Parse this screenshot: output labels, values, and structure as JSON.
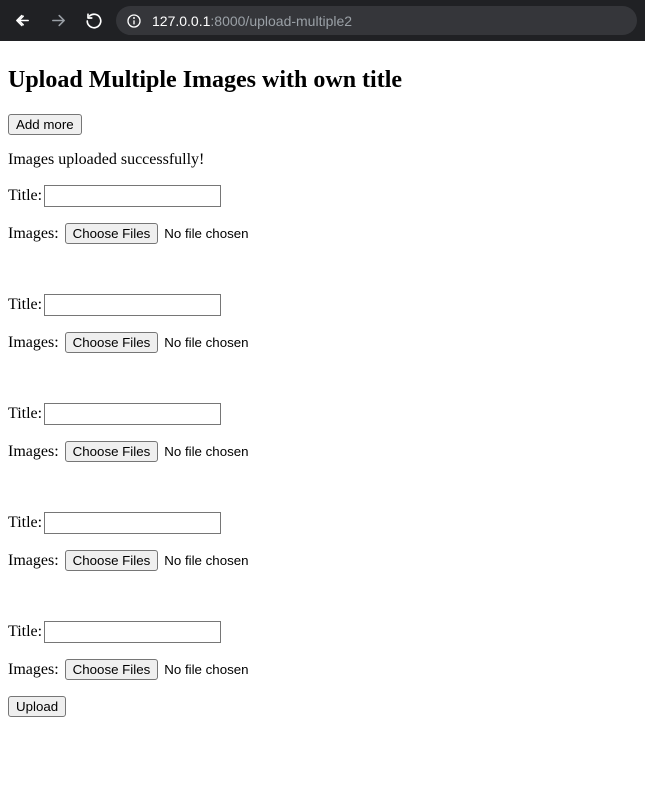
{
  "browser": {
    "url_host": "127.0.0.1",
    "url_port_path": ":8000/upload-multiple2"
  },
  "page": {
    "heading": "Upload Multiple Images with own title",
    "add_more_label": "Add more",
    "status_message": "Images uploaded successfully!",
    "upload_label": "Upload"
  },
  "labels": {
    "title": "Title:",
    "images": "Images:",
    "choose_files": "Choose Files",
    "no_file_chosen": "No file chosen"
  },
  "blocks": [
    {
      "title_value": ""
    },
    {
      "title_value": ""
    },
    {
      "title_value": ""
    },
    {
      "title_value": ""
    },
    {
      "title_value": ""
    }
  ]
}
